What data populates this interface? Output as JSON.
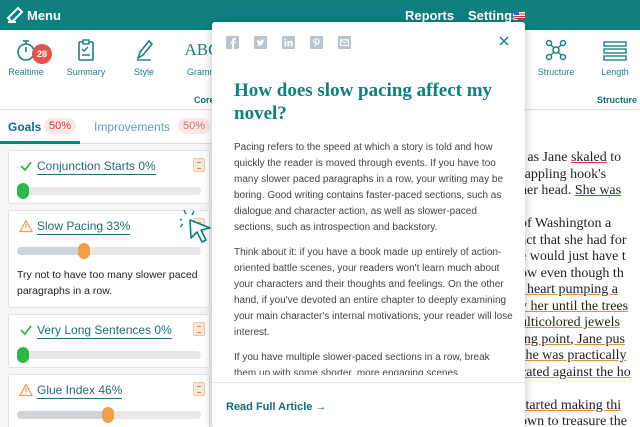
{
  "topbar": {
    "menu_label": "Menu",
    "reports_label": "Reports",
    "settings_label": "Settings"
  },
  "toolbar": {
    "tools": [
      {
        "label": "Realtime",
        "icon": "stopwatch-icon",
        "badge": "28"
      },
      {
        "label": "Summary",
        "icon": "clipboard-icon"
      },
      {
        "label": "Style",
        "icon": "pen-icon"
      },
      {
        "label": "Gramm",
        "icon": "abc-icon",
        "glyph": "ABC"
      },
      {
        "label": "Structure",
        "icon": "structure-icon"
      },
      {
        "label": "Length",
        "icon": "ruler-icon"
      }
    ],
    "group_core": "Core",
    "group_structure": "Structure"
  },
  "tabs": {
    "goals_label": "Goals",
    "goals_pct": "50%",
    "improvements_label": "Improvements",
    "improvements_pct": "50%"
  },
  "goals": [
    {
      "title": "Conjunction Starts 0%",
      "status": "ok",
      "level": 0.0
    },
    {
      "title": "Slow Pacing 33%",
      "status": "warning",
      "level": 0.33,
      "description": "Try not to have too many slower paced paragraphs in a row."
    },
    {
      "title": "Very Long Sentences 0%",
      "status": "ok",
      "level": 0.0
    },
    {
      "title": "Glue Index 46%",
      "status": "warning",
      "level": 0.46
    }
  ],
  "colors": {
    "brand": "#0f7f80",
    "ok": "#2fb84a",
    "warning": "#f0a04b",
    "badge": "#e4544f"
  },
  "document_lines": [
    {
      "text": "t as Jane ",
      "underlined": "skaled",
      "rest": " to",
      "style": "red"
    },
    {
      "text": "rappling hook's",
      "style": ""
    },
    {
      "text": "her head. ",
      "underlined": "She was",
      "style": "blue"
    },
    {
      "text": "",
      "style": ""
    },
    {
      "text": "of Washington a",
      "style": ""
    },
    {
      "text": "act that she had for",
      "style": ""
    },
    {
      "text": "e would just have t",
      "style": ""
    },
    {
      "text": "ow even though th",
      "style": ""
    },
    {
      "text": ", heart pumping a",
      "style": "orange"
    },
    {
      "text": "y her until the trees",
      "style": "orange"
    },
    {
      "text": "ulticolored jewels",
      "style": "orange"
    },
    {
      "text": "ing point, Jane pus",
      "style": "orange"
    },
    {
      "text": "she was practically",
      "style": "orange"
    },
    {
      "text": "cated against the ho",
      "style": "orange"
    },
    {
      "text": "",
      "style": ""
    },
    {
      "text": "started making thi",
      "style": "orange"
    },
    {
      "text": "own to treasure the",
      "style": ""
    }
  ],
  "popup": {
    "share_icons": [
      "facebook-icon",
      "twitter-icon",
      "linkedin-icon",
      "pinterest-icon",
      "email-icon"
    ],
    "title": "How does slow pacing affect my novel?",
    "paragraphs": [
      "Pacing refers to the speed at which a story is told and how quickly the reader is moved through events. If you have too many slower paced paragraphs in a row, your writing may be boring. Good writing contains faster-paced sections, such as dialogue and character action, as well as slower-paced sections, such as introspection and backstory.",
      "Think about it: if you have a book made up entirely of action-oriented battle scenes, your readers won't learn much about your characters and their thoughts and feelings. On the other hand, if you've devoted an entire chapter to deeply examining your main character's internal motivations, your reader will lose interest.",
      "If you have multiple slower-paced sections in a row, break them up with some shorter, more engaging scenes."
    ],
    "read_more": "Read Full Article →"
  }
}
